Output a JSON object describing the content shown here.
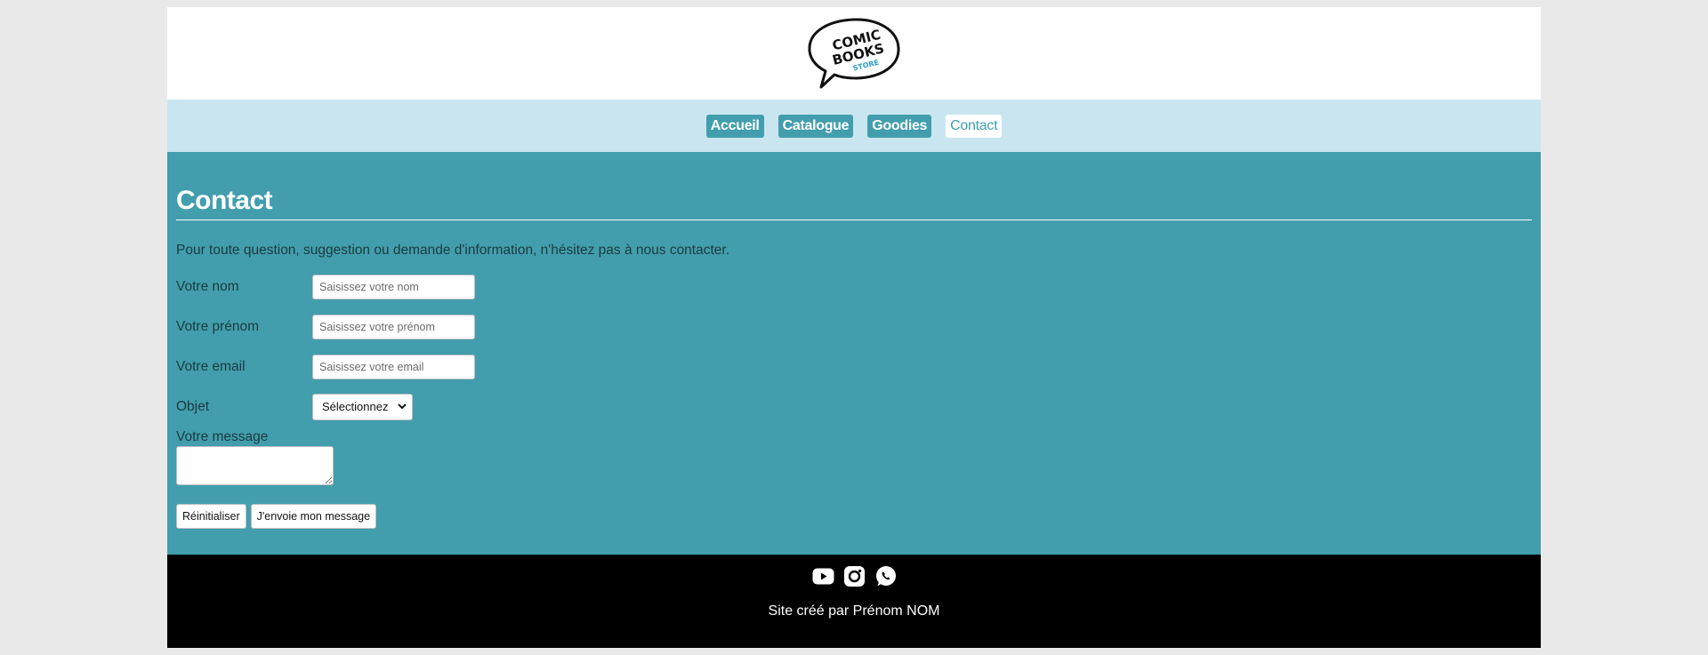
{
  "header": {
    "logo": {
      "line1": "COMIC",
      "line2": "BOOKS",
      "line3": "STORE",
      "accent_color": "#2a9fc6"
    }
  },
  "nav": {
    "items": [
      {
        "label": "Accueil",
        "active": false
      },
      {
        "label": "Catalogue",
        "active": false
      },
      {
        "label": "Goodies",
        "active": false
      },
      {
        "label": "Contact",
        "active": true
      }
    ]
  },
  "main": {
    "title": "Contact",
    "intro": "Pour toute question, suggestion ou demande d'information, n'hésitez pas à nous contacter.",
    "form": {
      "name": {
        "label": "Votre nom",
        "placeholder": "Saisissez votre nom"
      },
      "firstname": {
        "label": "Votre prénom",
        "placeholder": "Saisissez votre prénom"
      },
      "email": {
        "label": "Votre email",
        "placeholder": "Saisissez votre email"
      },
      "subject": {
        "label": "Objet",
        "selected": "Sélectionnez"
      },
      "message": {
        "label": "Votre message"
      },
      "reset_label": "Réinitialiser",
      "submit_label": "J'envoie mon message"
    }
  },
  "footer": {
    "socials": [
      "youtube-icon",
      "instagram-icon",
      "whatsapp-icon"
    ],
    "credit": "Site créé par Prénom NOM"
  },
  "colors": {
    "page_bg": "#e9e9e9",
    "nav_bg": "#c9e6f0",
    "accent": "#429ead",
    "footer_bg": "#000000"
  }
}
